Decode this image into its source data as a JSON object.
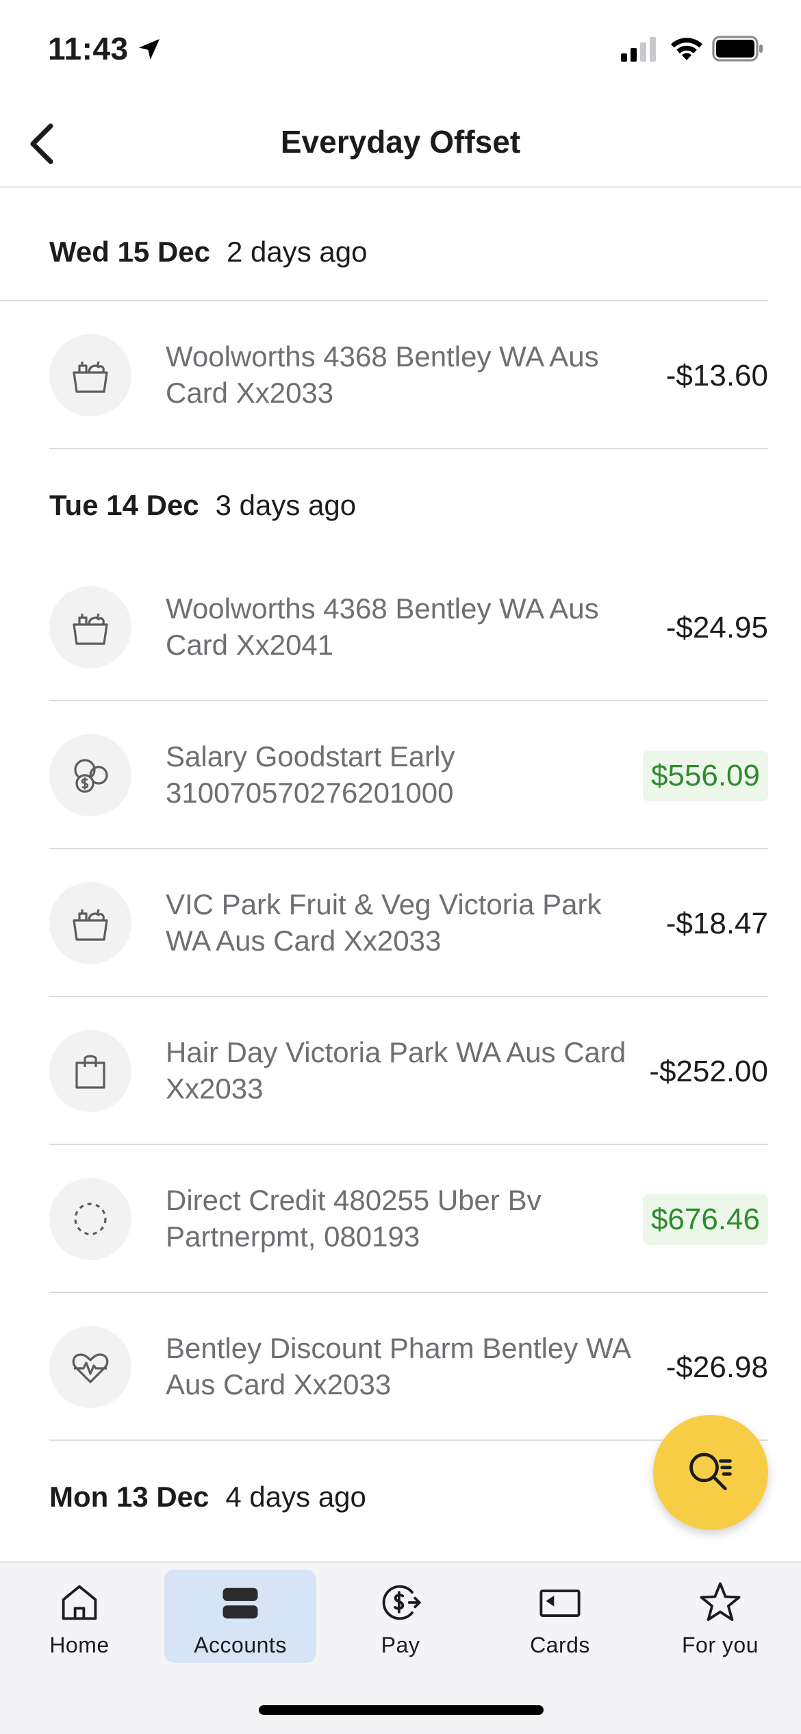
{
  "status_bar": {
    "time": "11:43"
  },
  "header": {
    "title": "Everyday Offset"
  },
  "groups": [
    {
      "date": "Wed 15 Dec",
      "relative": "2 days ago",
      "transactions": [
        {
          "icon": "groceries-icon",
          "description": "Woolworths 4368 Bentley WA Aus Card Xx2033",
          "amount": "-$13.60",
          "type": "debit"
        }
      ]
    },
    {
      "date": "Tue 14 Dec",
      "relative": "3 days ago",
      "transactions": [
        {
          "icon": "groceries-icon",
          "description": "Woolworths 4368 Bentley WA Aus Card Xx2041",
          "amount": "-$24.95",
          "type": "debit"
        },
        {
          "icon": "income-coins-icon",
          "description": "Salary Goodstart Early 310070570276201000",
          "amount": "$556.09",
          "type": "credit"
        },
        {
          "icon": "groceries-icon",
          "description": "VIC Park Fruit & Veg Victoria Park WA Aus Card Xx2033",
          "amount": "-$18.47",
          "type": "debit"
        },
        {
          "icon": "shopping-bag-icon",
          "description": "Hair Day Victoria Park WA Aus Card Xx2033",
          "amount": "-$252.00",
          "type": "debit"
        },
        {
          "icon": "dashed-circle-icon",
          "description": "Direct Credit 480255 Uber Bv Partnerpmt, 080193",
          "amount": "$676.46",
          "type": "credit"
        },
        {
          "icon": "heart-pulse-icon",
          "description": "Bentley Discount Pharm Bentley WA Aus Card Xx2033",
          "amount": "-$26.98",
          "type": "debit"
        }
      ]
    },
    {
      "date": "Mon 13 Dec",
      "relative": "4 days ago",
      "transactions": []
    }
  ],
  "fab": {
    "icon": "search-filter-icon"
  },
  "tabs": [
    {
      "label": "Home",
      "icon": "home-icon",
      "active": false
    },
    {
      "label": "Accounts",
      "icon": "accounts-icon",
      "active": true
    },
    {
      "label": "Pay",
      "icon": "pay-icon",
      "active": false
    },
    {
      "label": "Cards",
      "icon": "card-icon",
      "active": false
    },
    {
      "label": "For you",
      "icon": "star-icon",
      "active": false
    }
  ],
  "colors": {
    "accent_yellow": "#f7cd45",
    "credit_green": "#2e8b2e",
    "credit_bg": "#ecf7ea",
    "active_tab_bg": "#d7e4f6"
  }
}
